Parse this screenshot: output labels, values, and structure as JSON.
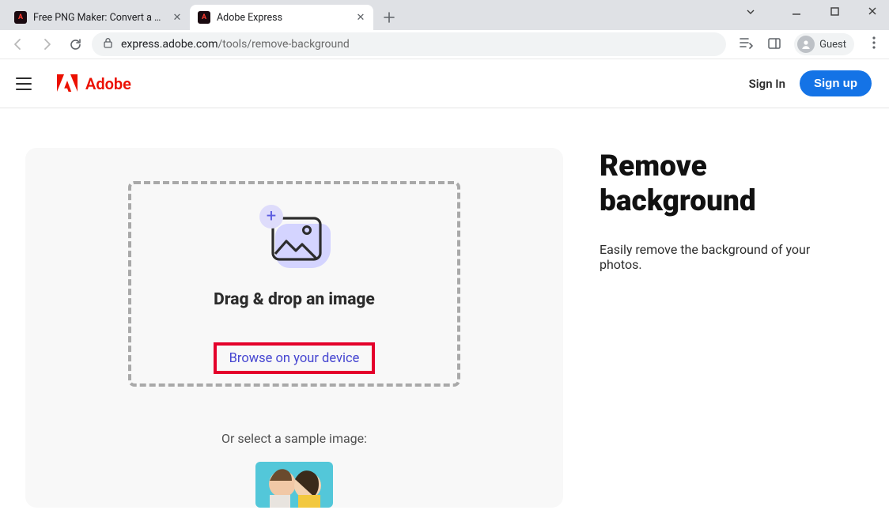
{
  "browser": {
    "tabs": [
      {
        "title": "Free PNG Maker: Convert a JPG",
        "active": false
      },
      {
        "title": "Adobe Express",
        "active": true
      }
    ],
    "url_host": "express.adobe.com",
    "url_path": "/tools/remove-background",
    "guest_label": "Guest"
  },
  "header": {
    "brand": "Adobe",
    "sign_in": "Sign In",
    "sign_up": "Sign up"
  },
  "drop": {
    "title": "Drag & drop an image",
    "browse": "Browse on your device",
    "sample_label": "Or select a sample image:"
  },
  "hero": {
    "title_line1": "Remove",
    "title_line2": "background",
    "subtitle": "Easily remove the background of your photos."
  }
}
